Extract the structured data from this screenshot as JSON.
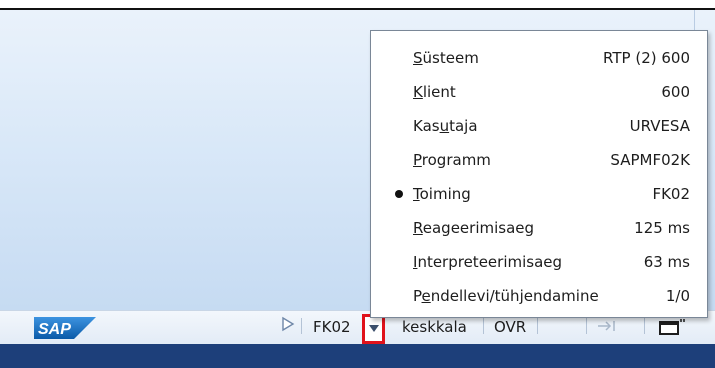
{
  "statusbar": {
    "transaction": "FK02",
    "mode": "keskkala",
    "insert_mode": "OVR",
    "menu_open": true
  },
  "system_info_menu": {
    "items": [
      {
        "pre": "",
        "key": "S",
        "post": "üsteem",
        "value": "RTP (2) 600",
        "selected": false
      },
      {
        "pre": "",
        "key": "K",
        "post": "lient",
        "value": "600",
        "selected": false
      },
      {
        "pre": "Kas",
        "key": "u",
        "post": "taja",
        "value": "URVESA",
        "selected": false
      },
      {
        "pre": "",
        "key": "P",
        "post": "rogramm",
        "value": "SAPMF02K",
        "selected": false
      },
      {
        "pre": "",
        "key": "T",
        "post": "oiming",
        "value": "FK02",
        "selected": true
      },
      {
        "pre": "",
        "key": "R",
        "post": "eageerimisaeg",
        "value": "125 ms",
        "selected": false
      },
      {
        "pre": "",
        "key": "I",
        "post": "nterpreteerimisaeg",
        "value": "63 ms",
        "selected": false
      },
      {
        "pre": "P",
        "key": "e",
        "post": "ndellevi/tühjendamine",
        "value": "1/0",
        "selected": false
      }
    ]
  },
  "colors": {
    "highlight_box": "#e0121b",
    "sap_logo_blue": "#1f6fbf",
    "taskbar": "#1d3f7a"
  },
  "icons": {
    "logo": "sap-logo",
    "play": "play-triangle-icon",
    "dropdown": "chevron-down-icon",
    "enter": "enter-arrow-icon",
    "window": "window-icon"
  }
}
